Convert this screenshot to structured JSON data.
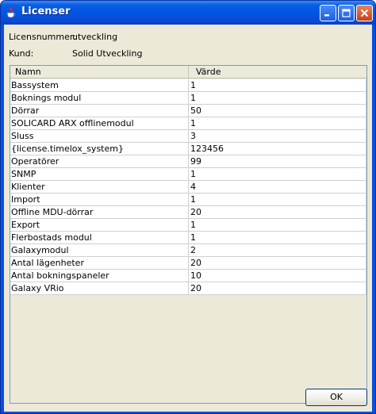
{
  "window": {
    "title": "Licenser",
    "icon": "java-cup-icon"
  },
  "info": {
    "license_label": "Licensnummer:",
    "license_value": "utveckling",
    "customer_label": "Kund:",
    "customer_value": "Solid Utveckling"
  },
  "table": {
    "columns": [
      "Namn",
      "Värde"
    ],
    "rows": [
      {
        "name": "Bassystem",
        "value": "1"
      },
      {
        "name": "Boknings modul",
        "value": "1"
      },
      {
        "name": "Dörrar",
        "value": "50"
      },
      {
        "name": "SOLICARD ARX offlinemodul",
        "value": "1"
      },
      {
        "name": "Sluss",
        "value": "3"
      },
      {
        "name": "{license.timelox_system}",
        "value": "123456"
      },
      {
        "name": "Operatörer",
        "value": "99"
      },
      {
        "name": "SNMP",
        "value": "1"
      },
      {
        "name": "Klienter",
        "value": "4"
      },
      {
        "name": "Import",
        "value": "1"
      },
      {
        "name": "Offline MDU-dörrar",
        "value": "20"
      },
      {
        "name": "Export",
        "value": "1"
      },
      {
        "name": "Flerbostads modul",
        "value": "1"
      },
      {
        "name": "Galaxymodul",
        "value": "2"
      },
      {
        "name": "Antal lägenheter",
        "value": "20"
      },
      {
        "name": "Antal bokningspaneler",
        "value": "10"
      },
      {
        "name": "Galaxy VRio",
        "value": "20"
      }
    ]
  },
  "buttons": {
    "ok_label": "OK"
  }
}
